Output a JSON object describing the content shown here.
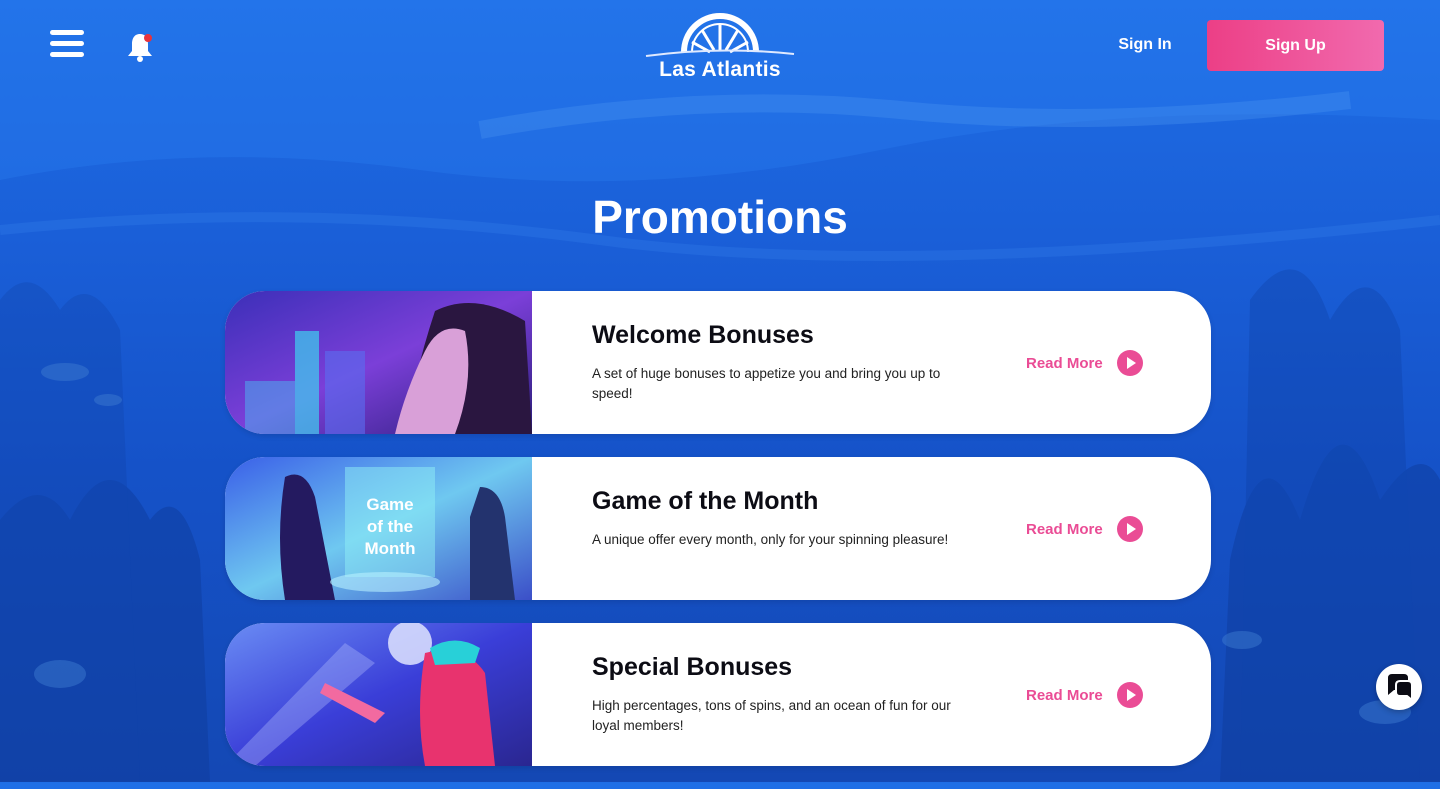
{
  "header": {
    "menu_icon": "hamburger-menu-icon",
    "notification_icon": "bell-icon",
    "logo_text": "Las Atlantis",
    "signin_label": "Sign In",
    "signup_label": "Sign Up"
  },
  "page_title": "Promotions",
  "promotions": [
    {
      "title": "Welcome Bonuses",
      "description": "A set of huge bonuses to appetize you and bring you up to speed!",
      "read_more": "Read More",
      "image_label": ""
    },
    {
      "title": "Game of the Month",
      "description": "A unique offer every month, only for your spinning pleasure!",
      "read_more": "Read More",
      "image_label": "Game of the Month"
    },
    {
      "title": "Special Bonuses",
      "description": "High percentages, tons of spins, and an ocean of fun for our loyal members!",
      "read_more": "Read More",
      "image_label": ""
    }
  ],
  "chat_icon": "chat-bubble-icon",
  "colors": {
    "accent_pink": "#ea4c95",
    "background_blue": "#1a5fd8",
    "card_background": "#ffffff"
  }
}
